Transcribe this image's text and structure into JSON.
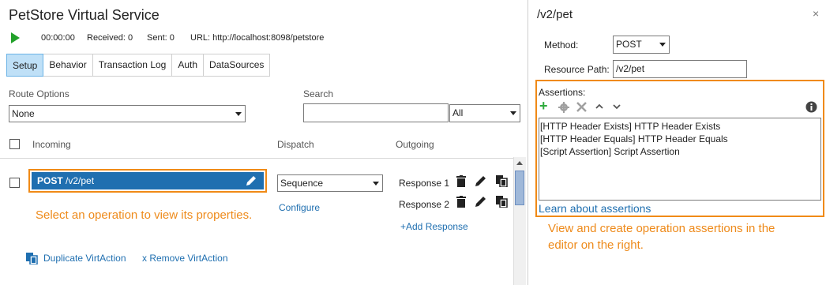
{
  "service": {
    "title": "PetStore Virtual Service",
    "time": "00:00:00",
    "received": "Received: 0",
    "sent": "Sent: 0",
    "url": "URL: http://localhost:8098/petstore"
  },
  "tabs": [
    "Setup",
    "Behavior",
    "Transaction Log",
    "Auth",
    "DataSources"
  ],
  "route_options": {
    "label": "Route Options",
    "value": "None"
  },
  "search": {
    "label": "Search",
    "value": "",
    "filter": "All"
  },
  "columns": {
    "incoming": "Incoming",
    "dispatch": "Dispatch",
    "outgoing": "Outgoing"
  },
  "operation": {
    "method": "POST",
    "path": "/v2/pet",
    "dispatch": "Sequence",
    "configure": "Configure",
    "responses": [
      "Response 1",
      "Response 2"
    ],
    "add_response": "+Add Response"
  },
  "notes": {
    "left": "Select an operation to view its properties.",
    "right_1": "View and create operation assertions in the",
    "right_2": "editor on the right."
  },
  "actions": {
    "duplicate": "Duplicate VirtAction",
    "remove": "x Remove VirtAction"
  },
  "properties": {
    "title": "/v2/pet",
    "method_label": "Method:",
    "method_value": "POST",
    "path_label": "Resource Path:",
    "path_value": "/v2/pet",
    "assertions_label": "Assertions:",
    "assertions": [
      "[HTTP Header Exists] HTTP Header Exists",
      "[HTTP Header Equals] HTTP Header Equals",
      "[Script Assertion] Script Assertion"
    ],
    "learn_link": "Learn about assertions"
  },
  "colors": {
    "accent_orange": "#f08a16",
    "selected_blue": "#1f6fb0",
    "play_green": "#22a12a"
  }
}
